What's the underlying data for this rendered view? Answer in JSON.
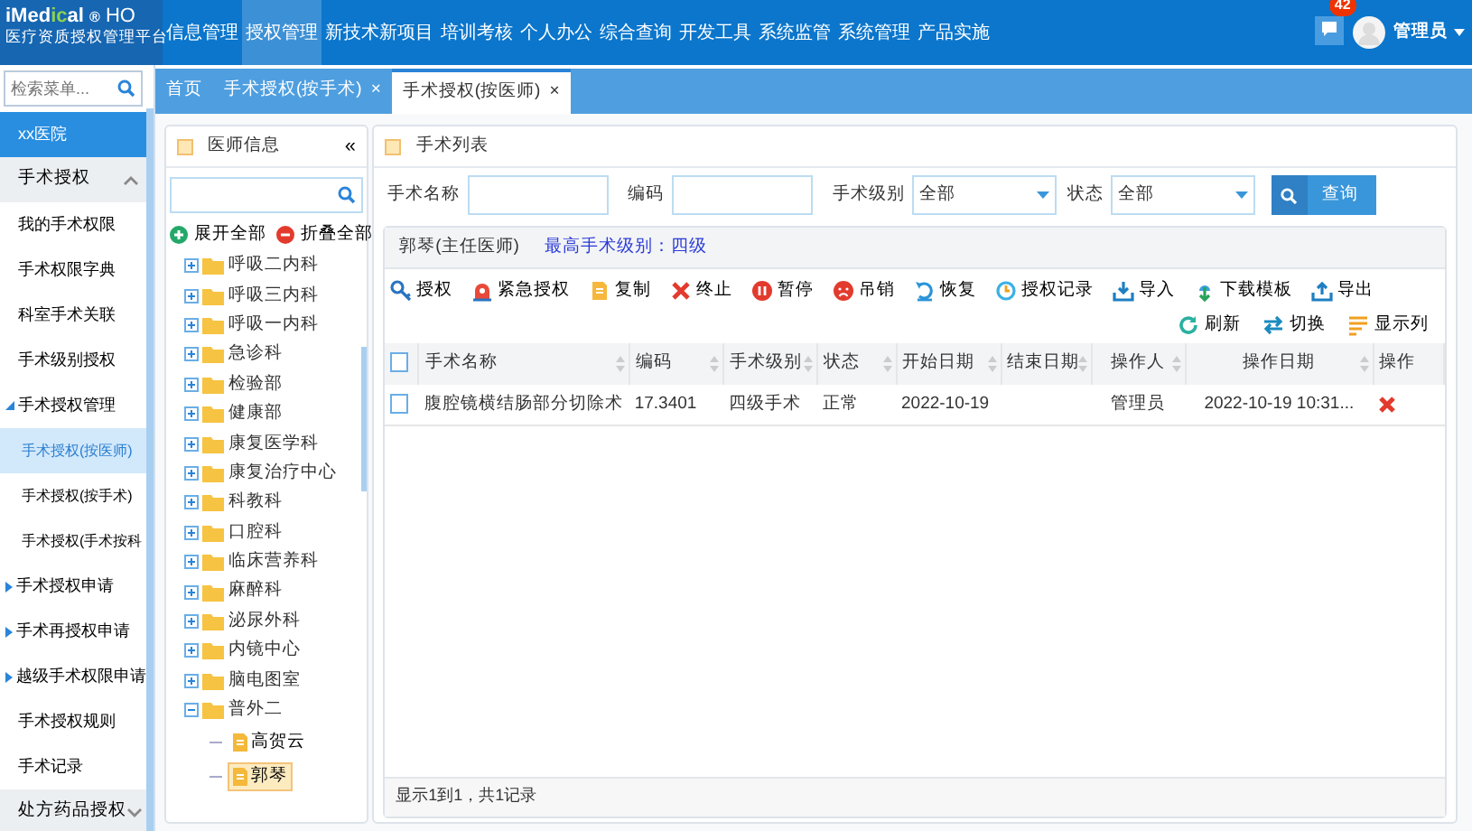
{
  "header": {
    "logo": "iMedical",
    "logo_mark": "®",
    "logo_suffix": "HO",
    "subtitle": "医疗资质授权管理平台",
    "nav": [
      {
        "label": "信息管理",
        "selected": false
      },
      {
        "label": "授权管理",
        "selected": true
      },
      {
        "label": "新技术新项目",
        "selected": false
      },
      {
        "label": "培训考核",
        "selected": false
      },
      {
        "label": "个人办公",
        "selected": false
      },
      {
        "label": "综合查询",
        "selected": false
      },
      {
        "label": "开发工具",
        "selected": false
      },
      {
        "label": "系统监管",
        "selected": false
      },
      {
        "label": "系统管理",
        "selected": false
      },
      {
        "label": "产品实施",
        "selected": false
      }
    ],
    "message_count": "42",
    "user": "管理员"
  },
  "sidebar": {
    "search": {
      "placeholder": "检索菜单..."
    },
    "items": [
      {
        "kind": "org",
        "label": "xx医院",
        "selected": true
      },
      {
        "kind": "group",
        "label": "手术授权",
        "expanded": true,
        "children": [
          {
            "label": "我的手术权限",
            "selected": false
          },
          {
            "label": "手术权限字典",
            "selected": false
          },
          {
            "label": "科室手术关联",
            "selected": false
          },
          {
            "label": "手术级别授权",
            "selected": false
          },
          {
            "label": "手术授权管理",
            "expanded": true,
            "children": [
              {
                "label": "手术授权(按医师)",
                "selected": true
              },
              {
                "label": "手术授权(按手术)",
                "selected": false
              },
              {
                "label": "手术授权(手术按科",
                "selected": false
              }
            ]
          },
          {
            "label": "手术授权申请",
            "expanded": false
          },
          {
            "label": "手术再授权申请",
            "expanded": false
          },
          {
            "label": "越级手术权限申请",
            "expanded": false
          },
          {
            "label": "手术授权规则",
            "selected": false
          },
          {
            "label": "手术记录",
            "selected": false
          }
        ]
      },
      {
        "kind": "group",
        "label": "处方药品授权",
        "expanded": false
      }
    ]
  },
  "tabs": [
    {
      "label": "首页",
      "selected": false
    },
    {
      "label": "手术授权(按手术)",
      "selected": false,
      "close": "×"
    },
    {
      "label": "手术授权(按医师)",
      "selected": true,
      "close": "×"
    }
  ],
  "doctor_panel": {
    "title": "医师信息",
    "collapse": "«",
    "expand_all": "展开全部",
    "collapse_all": "折叠全部",
    "tree": [
      {
        "label": "呼吸二内科",
        "expanded": false
      },
      {
        "label": "呼吸三内科",
        "expanded": false
      },
      {
        "label": "呼吸一内科",
        "expanded": false
      },
      {
        "label": "急诊科",
        "expanded": false
      },
      {
        "label": "检验部",
        "expanded": false
      },
      {
        "label": "健康部",
        "expanded": false
      },
      {
        "label": "康复医学科",
        "expanded": false
      },
      {
        "label": "康复治疗中心",
        "expanded": false
      },
      {
        "label": "科教科",
        "expanded": false
      },
      {
        "label": "口腔科",
        "expanded": false
      },
      {
        "label": "临床营养科",
        "expanded": false
      },
      {
        "label": "麻醉科",
        "expanded": false
      },
      {
        "label": "泌尿外科",
        "expanded": false
      },
      {
        "label": "内镜中心",
        "expanded": false
      },
      {
        "label": "脑电图室",
        "expanded": false
      },
      {
        "label": "普外二",
        "expanded": true,
        "children": [
          {
            "label": "高贺云",
            "selected": false
          },
          {
            "label": "郭琴",
            "selected": true
          }
        ]
      }
    ]
  },
  "surgery_panel": {
    "title": "手术列表",
    "filters": [
      {
        "kind": "text",
        "label": "手术名称"
      },
      {
        "kind": "text",
        "label": "编码"
      },
      {
        "kind": "select",
        "label": "手术级别",
        "value": "全部"
      },
      {
        "kind": "select",
        "label": "状态",
        "value": "全部"
      }
    ],
    "query_button": "查询",
    "doctor": "郭琴(主任医师)",
    "max_level": "最高手术级别：四级",
    "toolbar": [
      {
        "kind": "key",
        "label": "授权"
      },
      {
        "kind": "alarm",
        "label": "紧急授权"
      },
      {
        "kind": "copy",
        "label": "复制"
      },
      {
        "kind": "stop",
        "label": "终止"
      },
      {
        "kind": "pause",
        "label": "暂停"
      },
      {
        "kind": "revoke",
        "label": "吊销"
      },
      {
        "kind": "restore",
        "label": "恢复"
      },
      {
        "kind": "history",
        "label": "授权记录"
      },
      {
        "kind": "import",
        "label": "导入"
      },
      {
        "kind": "download",
        "label": "下载模板"
      },
      {
        "kind": "export",
        "label": "导出"
      }
    ],
    "right_tools": [
      {
        "kind": "refresh",
        "label": "刷新"
      },
      {
        "kind": "switch",
        "label": "切换"
      },
      {
        "kind": "columns",
        "label": "显示列"
      }
    ],
    "table": {
      "header_checked": false,
      "columns": [
        {
          "label": "手术名称",
          "sortable": true
        },
        {
          "label": "编码",
          "sortable": true
        },
        {
          "label": "手术级别",
          "sortable": true
        },
        {
          "label": "状态",
          "sortable": true
        },
        {
          "label": "开始日期",
          "sortable": true
        },
        {
          "label": "结束日期",
          "sortable": true
        },
        {
          "label": "操作人",
          "sortable": true
        },
        {
          "label": "操作日期",
          "sortable": true
        },
        {
          "label": "操作",
          "sortable": false
        }
      ],
      "rows": [
        {
          "checked": false,
          "cells": [
            "腹腔镜横结肠部分切除术",
            "17.3401",
            "四级手术",
            "正常",
            "2022-10-19",
            "",
            "管理员",
            "2022-10-19 10:31..."
          ]
        }
      ]
    },
    "footer": "显示1到1，共1记录"
  }
}
